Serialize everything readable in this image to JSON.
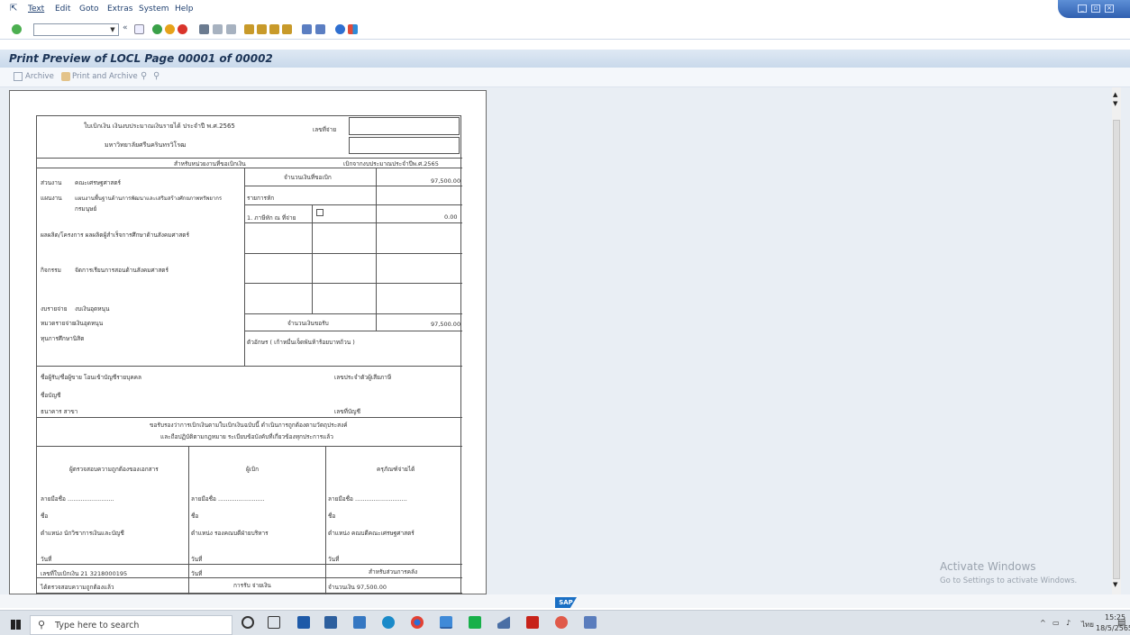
{
  "menu": {
    "items": [
      "Text",
      "Edit",
      "Goto",
      "Extras",
      "System",
      "Help"
    ]
  },
  "toolbar": {
    "command_field_value": "",
    "icons": [
      "enter-icon",
      "back-icon",
      "save-icon",
      "back-green-icon",
      "exit-icon",
      "cancel-icon",
      "print-icon",
      "find-icon",
      "find-next-icon",
      "first-page-icon",
      "prev-page-icon",
      "next-page-icon",
      "last-page-icon",
      "new-session-icon",
      "shortcut-icon",
      "help-icon",
      "layout-icon"
    ]
  },
  "window": {
    "title": "Print Preview of LOCL Page 00001 of 00002"
  },
  "app_toolbar": {
    "archive_label": "Archive",
    "print_archive_label": "Print and Archive"
  },
  "form": {
    "header_title": "ใบเบิกเงิน เงินงบประมาณเงินรายได้  ประจำปี พ.ศ.2565",
    "university": "มหาวิทยาลัยศรีนครินทรวิโรฒ",
    "doc_no_label": "เลขที่จ่าย",
    "for_unit_label": "สำหรับหน่วยงานที่ขอเบิกเงิน",
    "budget_year_label": "เบิกจากงบประมาณประจำปีพ.ศ.2565",
    "agency_label": "ส่วนงาน",
    "agency_value": "คณะเศรษฐศาสตร์",
    "amount_requested_label": "จำนวนเงินที่ขอเบิก",
    "amount_requested_value": "97,500.00",
    "plan_label": "แผนงาน",
    "plan_value": "แผนงานพื้นฐานด้านการพัฒนาและเสริมสร้างศักยภาพทรัพยากร",
    "plan_value2": "กรมนุษย์",
    "deduction_label": "รายการหัก",
    "withholding_label": "1. ภาษีหัก ณ ที่จ่าย",
    "withholding_value": "0.00",
    "project_label": "ผลผลิต/โครงการ  ผลผลิตผู้สำเร็จการศึกษาด้านสังคมศาสตร์",
    "activity_label": "กิจกรรม",
    "activity_value": "จัดการเรียนการสอนด้านสังคมศาสตร์",
    "budget_type_label": "งบรายจ่าย",
    "budget_type_value": "งบเงินอุดหนุน",
    "expense_cat_label": "หมวดรายจ่าย",
    "expense_cat_value": "เงินอุดหนุน",
    "net_amount_label": "จำนวนเงินขอรับ",
    "net_amount_value": "97,500.00",
    "fund_label": "ทุนการศึกษานิสิต",
    "amount_words_label": "ตัวอักษร ( เก้าหมื่นเจ็ดพันห้าร้อยบาทถ้วน )",
    "payee_label": "ชื่อผู้รับ/ชื่อผู้ขาย โอนเข้าบัญชีรายบุคคล",
    "taxid_label": "เลขประจำตัวผู้เสียภาษี",
    "account_name_label": "ชื่อบัญชี",
    "bank_label": "ธนาคาร สาขา",
    "account_no_label": "เลขที่บัญชี",
    "certify_1": "ขอรับรองว่าการเบิกเงินตามใบเบิกเงินฉบับนี้ ดำเนินการถูกต้องตามวัตถุประสงค์",
    "certify_2": "และถือปฏิบัติตามกฎหมาย ระเบียบข้อบังคับที่เกี่ยวข้องทุกประการแล้ว",
    "checker_title": "ผู้ตรวจสอบความถูกต้องของเอกสาร",
    "requester_title": "ผู้เบิก",
    "approver_title": "ครุภัณฑ์จ่ายได้",
    "sign_label": "ลายมือชื่อ .........................",
    "sign_label_approver": "ลายมือชื่อ ............................",
    "name_label": "ชื่อ",
    "pos_checker": "ตำแหน่ง   นักวิชาการเงินและบัญชี",
    "pos_requester": "ตำแหน่ง   รองคณบดีฝ่ายบริหาร",
    "pos_approver": "ตำแหน่ง   คณบดีคณะเศรษฐศาสตร์",
    "date_label": "วันที่",
    "ref_label": "เลขที่ใบเบิกเงิน   21 3218000195",
    "finance_label": "สำหรับส่วนการคลัง",
    "receive_label": "การรับ จ่ายเงิน",
    "amount_cut": "จำนวนเงิน 97,500.00",
    "bottom_cut": "ได้ตรวจสอบความถูกต้องแล้ว"
  },
  "watermark": {
    "line1": "Activate Windows",
    "line2": "Go to Settings to activate Windows."
  },
  "statusbar": {
    "sap_logo": "SAP"
  },
  "taskbar": {
    "search_placeholder": "Type here to search",
    "time": "15:25",
    "date": "18/5/2565",
    "lang": "ไทย"
  }
}
